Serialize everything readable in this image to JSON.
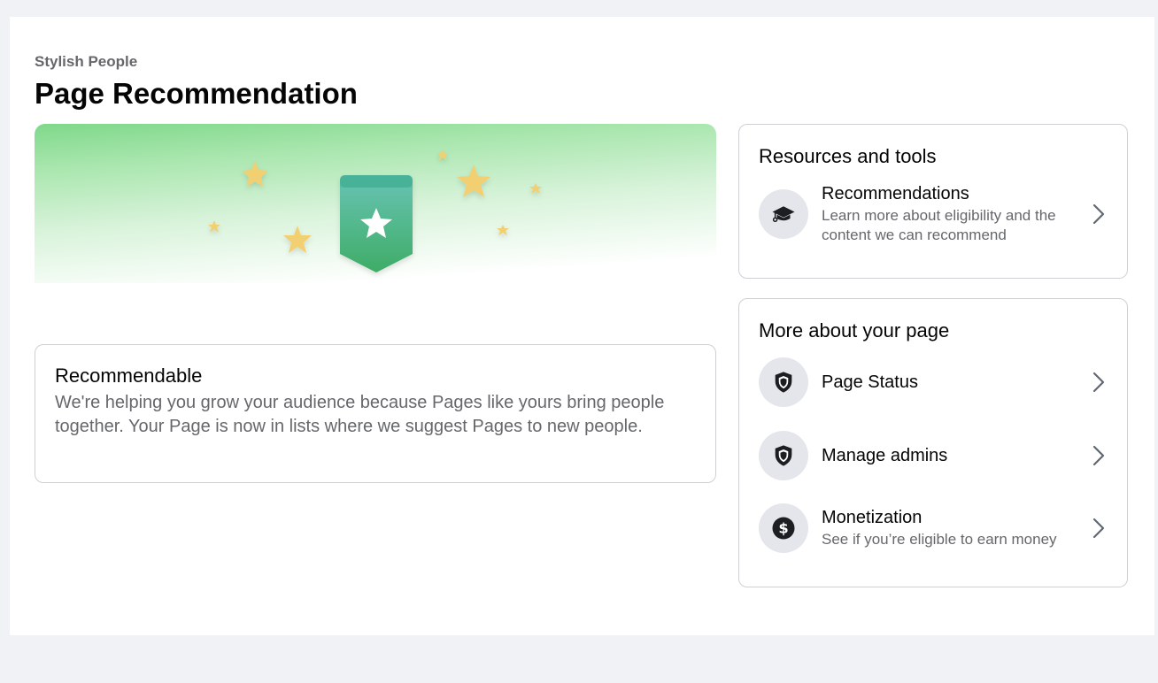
{
  "header": {
    "page_name": "Stylish People",
    "title": "Page Recommendation"
  },
  "banner": {
    "icon": "star-badge-icon"
  },
  "status": {
    "title": "Recommendable",
    "description": "We're helping you grow your audience because Pages like yours bring people together. Your Page is now in lists where we suggest Pages to new people."
  },
  "resources": {
    "heading": "Resources and tools",
    "items": [
      {
        "title": "Recommendations",
        "subtitle": "Learn more about eligibility and the content we can recommend",
        "icon": "graduation-cap-icon"
      }
    ]
  },
  "more": {
    "heading": "More about your page",
    "items": [
      {
        "title": "Page Status",
        "icon": "shield-icon"
      },
      {
        "title": "Manage admins",
        "icon": "shield-icon"
      },
      {
        "title": "Monetization",
        "subtitle": "See if you’re eligible to earn money",
        "icon": "dollar-coin-icon"
      }
    ]
  },
  "colors": {
    "background": "#f0f2f5",
    "badge_top": "#5bbfae",
    "badge_bottom": "#2fa65a",
    "star": "#f2cf6f"
  }
}
